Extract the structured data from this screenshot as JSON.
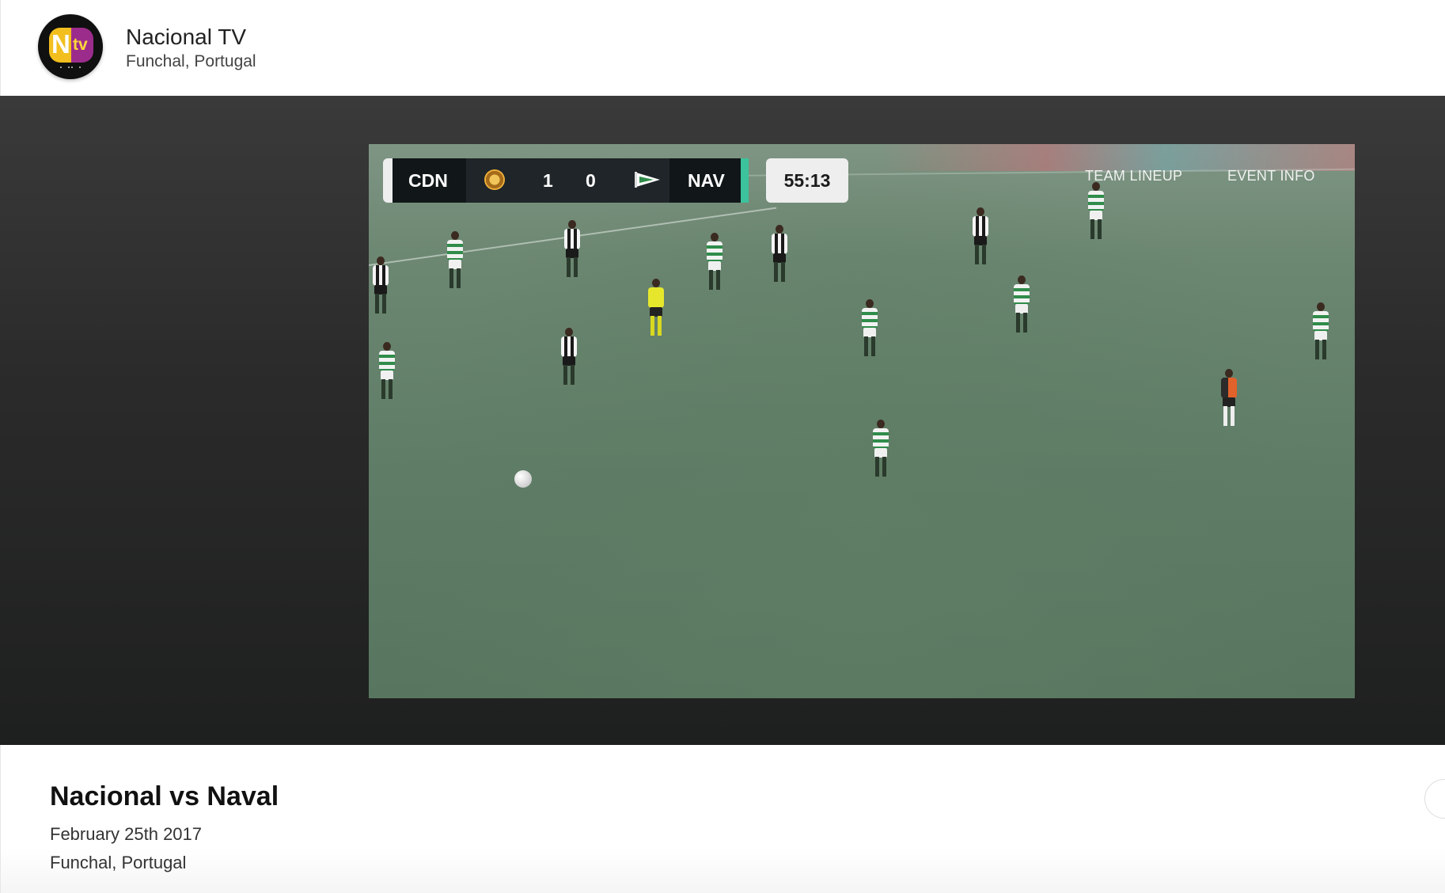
{
  "header": {
    "logo_letter": "N",
    "logo_suffix": "tv",
    "channel_name": "Nacional TV",
    "channel_location": "Funchal, Portugal"
  },
  "colors": {
    "logo_yellow": "#f2bf1e",
    "logo_purple": "#9c2c8c",
    "scoreboard_bg": "#111719",
    "scoreboard_accent": "#3cc39d",
    "clock_bg": "#eeeeee"
  },
  "player": {
    "scoreboard": {
      "home_code": "CDN",
      "home_score": "1",
      "away_score": "0",
      "away_code": "NAV",
      "home_crest_icon": "club-crest-icon",
      "away_crest_icon": "pennant-crest-icon"
    },
    "clock": "55:13",
    "links": {
      "team_lineup": "TEAM LINEUP",
      "event_info": "EVENT INFO"
    }
  },
  "event": {
    "title": "Nacional vs Naval",
    "date": "February 25th 2017",
    "location": "Funchal, Portugal"
  }
}
